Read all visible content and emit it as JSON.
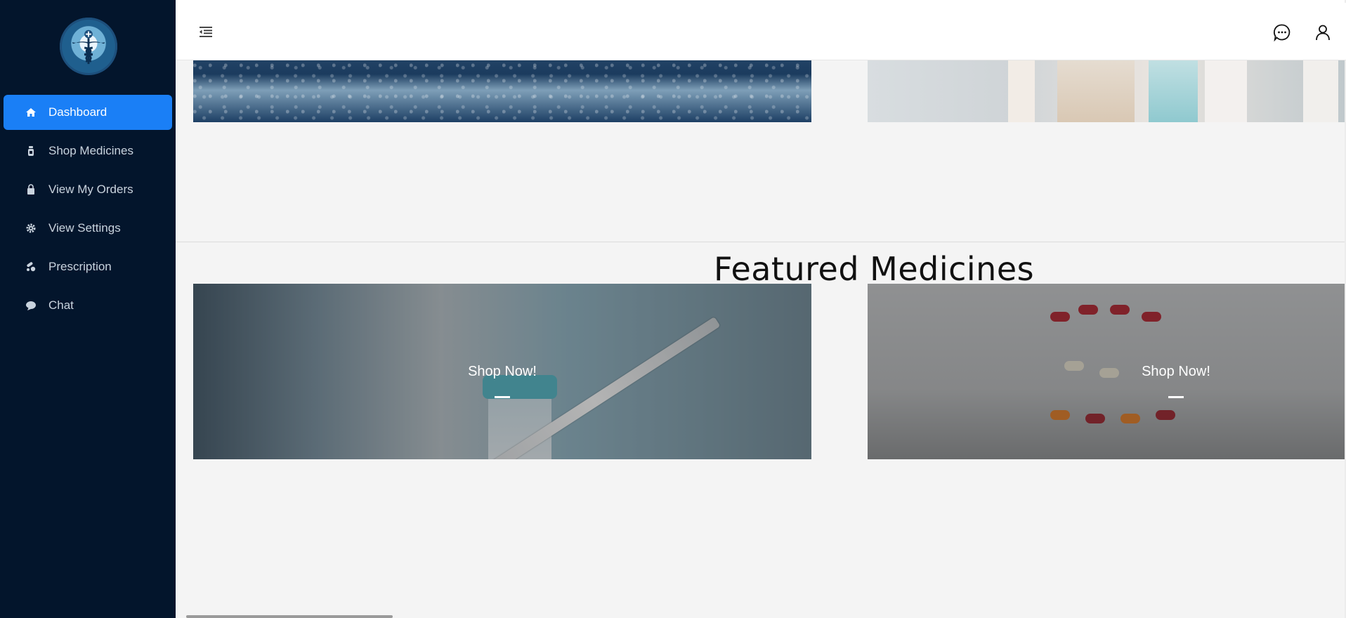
{
  "sidebar": {
    "logo_icon": "caduceus-icon",
    "items": [
      {
        "label": "Dashboard",
        "icon": "home-icon",
        "active": true
      },
      {
        "label": "Shop Medicines",
        "icon": "medicine-bottle-icon"
      },
      {
        "label": "View My Orders",
        "icon": "shopping-bag-icon"
      },
      {
        "label": "View Settings",
        "icon": "gear-icon"
      },
      {
        "label": "Prescription",
        "icon": "pills-icon"
      },
      {
        "label": "Chat",
        "icon": "chat-bubble-icon"
      }
    ]
  },
  "topbar": {
    "menu_icon": "menu-collapse-icon",
    "chat_icon": "chat-icon",
    "user_icon": "user-icon"
  },
  "main": {
    "featured_title": "Featured Medicines",
    "cards": [
      {
        "cta": "Shop Now!"
      },
      {
        "cta": "Shop Now!"
      }
    ]
  },
  "colors": {
    "sidebar_bg": "#03152c",
    "active_item": "#1a7ff6",
    "page_bg": "#f4f4f4"
  }
}
